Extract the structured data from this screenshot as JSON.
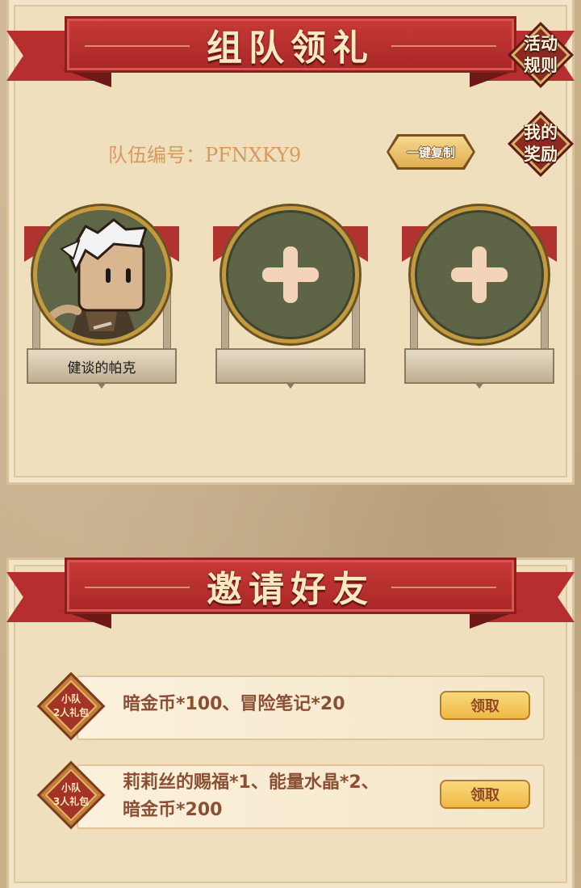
{
  "team_section": {
    "title": "组队领礼",
    "team_id_label": "队伍编号：PFNXKY9",
    "copy_button": "一键复制",
    "rules_badge": "活动\n规则",
    "rewards_badge": "我的\n奖励",
    "members": [
      {
        "name": "健谈的帕克",
        "filled": true
      },
      {
        "name": "",
        "filled": false
      },
      {
        "name": "",
        "filled": false
      }
    ]
  },
  "invite_section": {
    "title": "邀请好友",
    "rewards": [
      {
        "badge": "小队\n2人礼包",
        "description": "暗金币*100、冒险笔记*20",
        "button": "领取"
      },
      {
        "badge": "小队\n3人礼包",
        "description": "莉莉丝的赐福*1、能量水晶*2、\n暗金币*200",
        "button": "领取"
      }
    ]
  },
  "icons": [
    "plus-icon",
    "avatar-character"
  ],
  "colors": {
    "ribbon": "#b62f2e",
    "title_text": "#fbe9c2",
    "team_id": "#d69a5e",
    "slot_fill": "#5e6446",
    "claim_button": "#efb847"
  }
}
